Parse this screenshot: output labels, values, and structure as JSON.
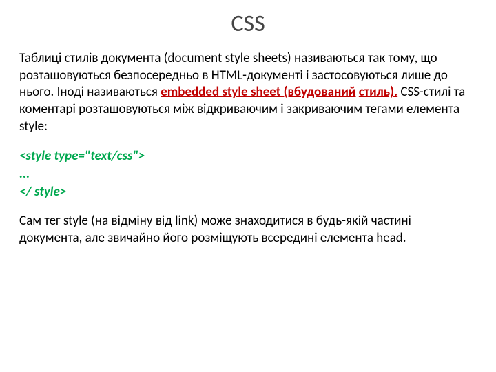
{
  "title": "CSS",
  "para1_pre": "Таблиці стилів документа (document style sheets) називаються так тому, що розташовуються безпосередньо в HTML-документі і застосовуються лише до нього. Іноді називаються ",
  "para1_link": "embedded style sheet (вбудований",
  "para1_link2": "стиль).",
  "para1_post": " CSS-стилі та коментарі розташовуються між відкриваючим і закриваючим тегами елемента style:",
  "code": {
    "l1": "<style type=\"text/css\">",
    "l2": " ...",
    "l3": "</ style>"
  },
  "para2": "Сам тег style (на відміну від link) може знаходитися в будь-якій частині документа, але звичайно його розміщують всередині елемента head."
}
